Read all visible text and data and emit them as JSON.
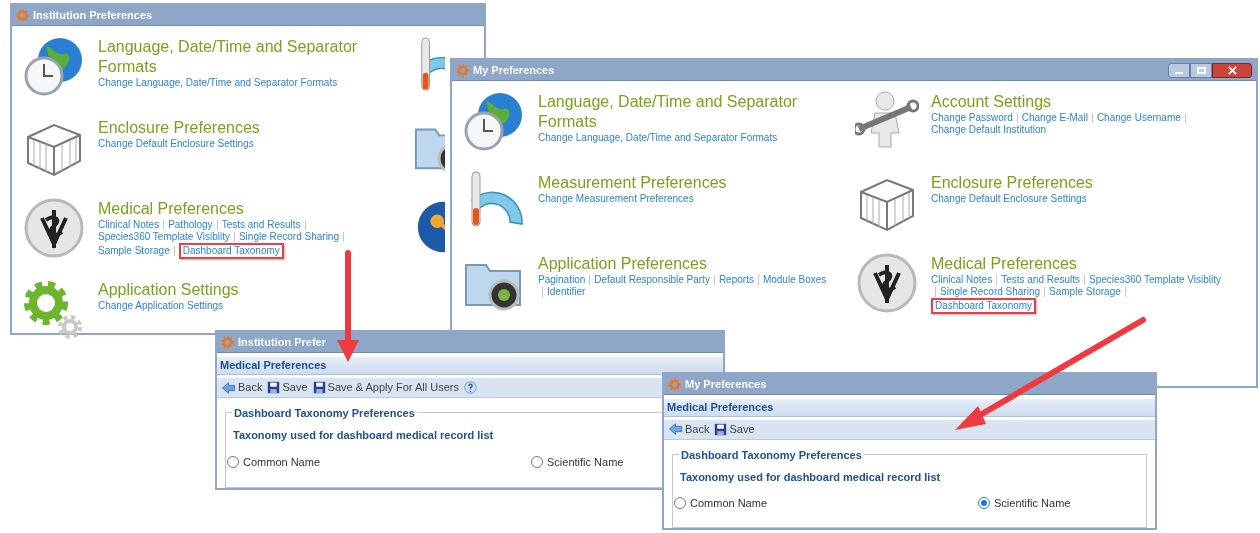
{
  "overview_windows": [
    {
      "title": "Institution Preferences",
      "columns": [
        [
          {
            "title": "Language, Date/Time and Separator Formats",
            "links": [
              {
                "text": "Change Language, Date/Time and Separator Formats",
                "highlighted": false
              }
            ]
          },
          {
            "title": "Enclosure Preferences",
            "links": [
              {
                "text": "Change Default Enclosure Settings",
                "highlighted": false
              }
            ]
          },
          {
            "title": "Medical Preferences",
            "links": [
              {
                "text": "Clinical Notes",
                "highlighted": false
              },
              {
                "text": "Pathology",
                "highlighted": false
              },
              {
                "text": "Tests and Results",
                "highlighted": false
              },
              {
                "text": "Species360 Template Visiblity",
                "highlighted": false
              },
              {
                "text": "Single Record Sharing",
                "highlighted": false
              },
              {
                "text": "Sample Storage",
                "highlighted": false
              },
              {
                "text": "Dashboard Taxonomy",
                "highlighted": true
              }
            ]
          },
          {
            "title": "Application Settings",
            "links": [
              {
                "text": "Change Application Settings",
                "highlighted": false
              }
            ]
          }
        ]
      ]
    },
    {
      "title": "My Preferences",
      "columns": [
        [
          {
            "title": "Language, Date/Time and Separator Formats",
            "links": [
              {
                "text": "Change Language, Date/Time and Separator Formats",
                "highlighted": false
              }
            ]
          },
          {
            "title": "Measurement Preferences",
            "links": [
              {
                "text": "Change Measurement Preferences",
                "highlighted": false
              }
            ]
          },
          {
            "title": "Application Preferences",
            "links": [
              {
                "text": "Pagination",
                "highlighted": false
              },
              {
                "text": "Default Responsible Party",
                "highlighted": false
              },
              {
                "text": "Reports",
                "highlighted": false
              },
              {
                "text": "Module Boxes",
                "highlighted": false
              },
              {
                "text": "Identifier",
                "highlighted": false
              }
            ]
          }
        ],
        [
          {
            "title": "Account Settings",
            "links": [
              {
                "text": "Change Password",
                "highlighted": false
              },
              {
                "text": "Change E-Mail",
                "highlighted": false
              },
              {
                "text": "Change Username",
                "highlighted": false
              },
              {
                "text": "Change Default Institution",
                "highlighted": false
              }
            ]
          },
          {
            "title": "Enclosure Preferences",
            "links": [
              {
                "text": "Change Default Enclosure Settings",
                "highlighted": false
              }
            ]
          },
          {
            "title": "Medical Preferences",
            "links": [
              {
                "text": "Clinical Notes",
                "highlighted": false
              },
              {
                "text": "Tests and Results",
                "highlighted": false
              },
              {
                "text": "Species360 Template Visiblity",
                "highlighted": false
              },
              {
                "text": "Single Record Sharing",
                "highlighted": false
              },
              {
                "text": "Sample Storage",
                "highlighted": false
              },
              {
                "text": "Dashboard Taxonomy",
                "highlighted": true
              }
            ]
          }
        ]
      ]
    }
  ],
  "detail_windows": [
    {
      "title": "Institution Prefer",
      "subtitle": "Medical Preferences",
      "toolbar": [
        {
          "kind": "back",
          "label": "Back"
        },
        {
          "kind": "save",
          "label": "Save"
        },
        {
          "kind": "save",
          "label": "Save & Apply For All Users"
        },
        {
          "kind": "help"
        }
      ],
      "legend": "Dashboard Taxonomy Preferences",
      "question": "Taxonomy used for dashboard medical record list",
      "options": [
        {
          "label": "Common Name",
          "selected": false
        },
        {
          "label": "Scientific Name",
          "selected": false
        }
      ]
    },
    {
      "title": "My Preferences",
      "subtitle": "Medical Preferences",
      "toolbar": [
        {
          "kind": "back",
          "label": "Back"
        },
        {
          "kind": "save",
          "label": "Save"
        }
      ],
      "legend": "Dashboard Taxonomy Preferences",
      "question": "Taxonomy used for dashboard medical record list",
      "options": [
        {
          "label": "Common Name",
          "selected": false
        },
        {
          "label": "Scientific Name",
          "selected": true
        }
      ]
    }
  ]
}
